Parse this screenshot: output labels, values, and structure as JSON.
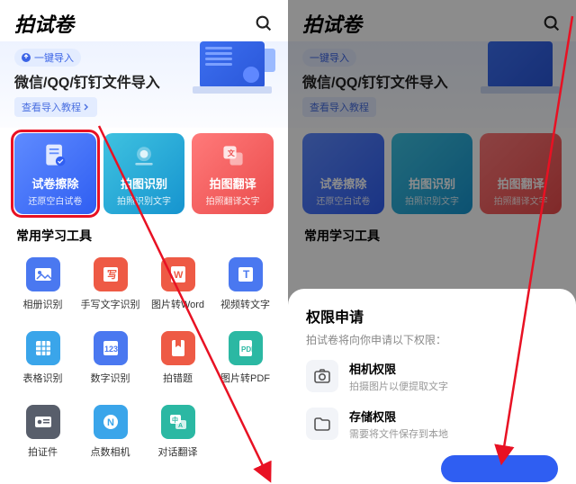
{
  "app_title": "拍试卷",
  "banner": {
    "pill": "一键导入",
    "heading": "微信/QQ/钉钉文件导入",
    "tutorial": "查看导入教程"
  },
  "cards": [
    {
      "title": "试卷擦除",
      "sub": "还原空白试卷"
    },
    {
      "title": "拍图识别",
      "sub": "拍照识别文字"
    },
    {
      "title": "拍图翻译",
      "sub": "拍照翻译文字"
    }
  ],
  "section": "常用学习工具",
  "tools": [
    "相册识别",
    "手写文字识别",
    "图片转Word",
    "视频转文字",
    "表格识别",
    "数字识别",
    "拍错题",
    "图片转PDF",
    "拍证件",
    "点数相机",
    "对话翻译"
  ],
  "sheet": {
    "title": "权限申请",
    "sub": "拍试卷将向你申请以下权限：",
    "perms": [
      {
        "title": "相机权限",
        "desc": "拍摄图片以便提取文字"
      },
      {
        "title": "存储权限",
        "desc": "需要将文件保存到本地"
      }
    ]
  }
}
